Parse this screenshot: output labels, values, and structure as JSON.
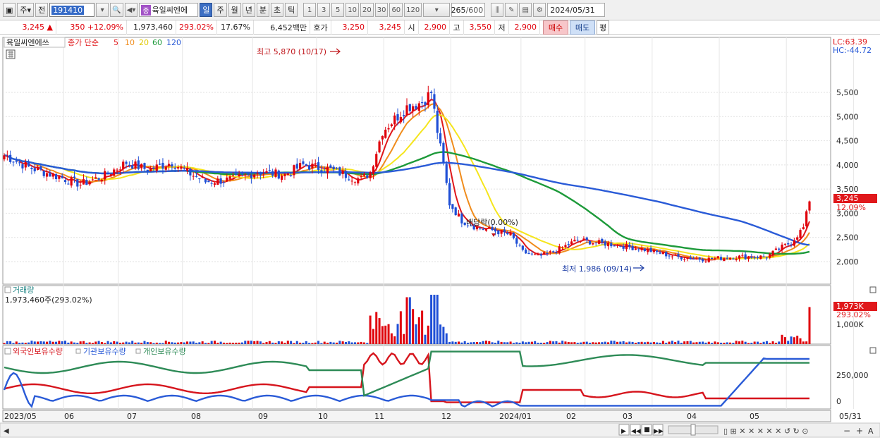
{
  "toolbar": {
    "type_label": "주",
    "prev_label": "전",
    "stock_code": "191410",
    "badge": "종",
    "stock_name": "육일씨엔에",
    "periods": [
      "일",
      "주",
      "월",
      "년",
      "분",
      "초",
      "틱"
    ],
    "active_period": "일",
    "minutes": [
      "1",
      "3",
      "5",
      "10",
      "20",
      "30",
      "60",
      "120"
    ],
    "count": "265",
    "count_max": "/600",
    "date": "2024/05/31"
  },
  "info": {
    "price": "3,245",
    "change_arrow": "▲",
    "change": "350",
    "change_pct": "+12.09%",
    "volume": "1,973,460",
    "volume_ratio": "293.02%",
    "turnover": "17.67%",
    "amount": "6,452백만",
    "quote_label": "호가",
    "ask": "3,250",
    "bid": "3,245",
    "open_label": "시",
    "open": "2,900",
    "high_label": "고",
    "high": "3,550",
    "low_label": "저",
    "low": "2,900",
    "buy_label": "매수",
    "sell_label": "매도",
    "eval_label": "평"
  },
  "price_pane": {
    "stock_name": "육일씨엔에쓰",
    "legend_prefix": "종가 단순",
    "ma": [
      {
        "label": "5",
        "color": "#e0181b"
      },
      {
        "label": "10",
        "color": "#f08c1c"
      },
      {
        "label": "20",
        "color": "#f5e51c"
      },
      {
        "label": "60",
        "color": "#1d9a3a"
      },
      {
        "label": "120",
        "color": "#2a5bd7"
      }
    ],
    "lc": "LC:63.39",
    "hc": "HC:-44.72",
    "max_label": "최고 5,870 (10/17)",
    "min_label": "최저 1,986 (09/14)",
    "dividend_label": "배당락(0.00%)",
    "current_price": "3,245",
    "current_pct": "12.09%",
    "y_ticks": [
      "5,500",
      "5,000",
      "4,500",
      "4,000",
      "3,500",
      "3,000",
      "2,500",
      "2,000"
    ]
  },
  "volume_pane": {
    "title": "거래량",
    "value": "1,973,460주(293.02%)",
    "current": "1,973K",
    "current_pct": "293.02%",
    "tick": "1,000K"
  },
  "holding_pane": {
    "series": [
      {
        "name": "외국인보유수량",
        "color": "#d6151d"
      },
      {
        "name": "기관보유수량",
        "color": "#2a5bd7"
      },
      {
        "name": "개인보유수량",
        "color": "#2e8b57"
      }
    ],
    "tick_250": "250,000",
    "tick_0": "0"
  },
  "x_labels": [
    "2023/05",
    "06",
    "07",
    "08",
    "09",
    "10",
    "11",
    "12",
    "2024/01",
    "02",
    "03",
    "04",
    "05",
    "05/31"
  ],
  "colors": {
    "up": "#e0000b",
    "down": "#1f4fd6",
    "grid": "#d8d8d8"
  }
}
